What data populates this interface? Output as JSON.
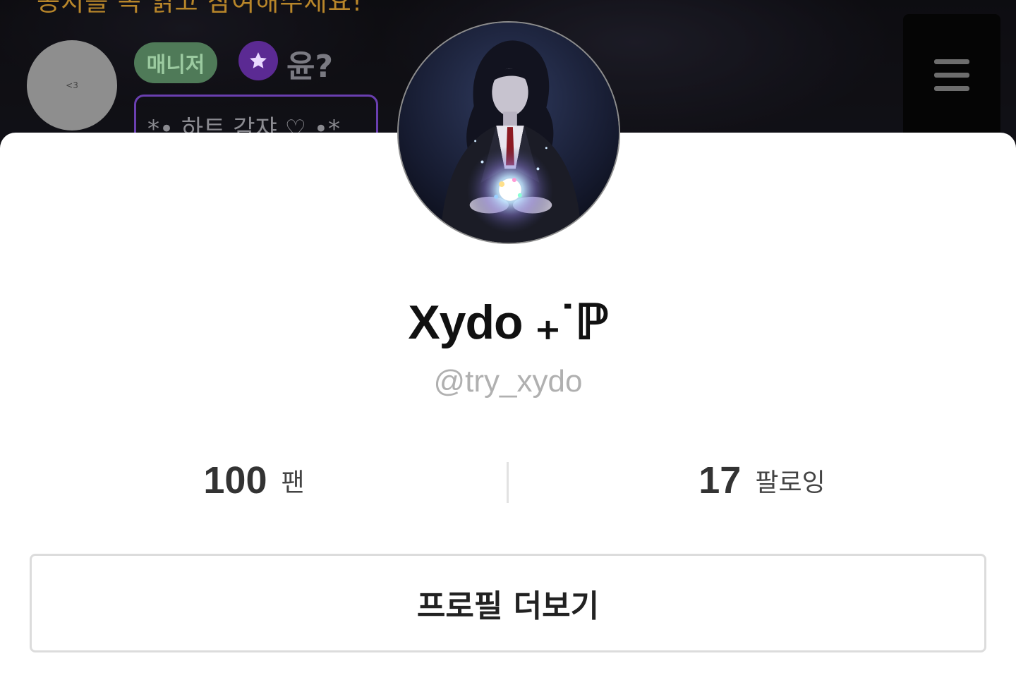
{
  "background": {
    "notice_text": "공지를 꼭 읽고 참여해주세요!",
    "chat_user": {
      "avatar_text": "<3",
      "role_badge": "매니저",
      "name": "윤?",
      "message_preview": "*• 하트 감쟈 ♡ •*"
    }
  },
  "profile": {
    "name": "Xydo ₊˙ℙ",
    "handle": "@try_xydo",
    "stats": {
      "fans_count": "100",
      "fans_label": "팬",
      "following_count": "17",
      "following_label": "팔로잉"
    },
    "more_button_label": "프로필 더보기"
  },
  "icons": {
    "star": "star-icon",
    "menu": "hamburger-menu-icon"
  },
  "colors": {
    "role_badge": "#4f7a58",
    "star_badge": "#5b2a93",
    "message_border": "#6a3fb0",
    "notice": "#b8862a"
  }
}
